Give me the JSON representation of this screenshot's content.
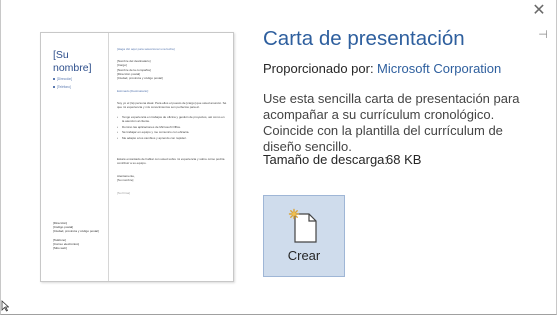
{
  "dialog": {
    "close_label": "✕",
    "pin_label": "⊣"
  },
  "preview": {
    "name_line1": "[Su",
    "name_line2": "nombre]",
    "side_items": [
      "[Dirección]",
      "[Teléfono]"
    ],
    "header_link": "[Haga clic aquí para seleccionar una fecha]",
    "recipient": [
      "[Nombre del destinatario]",
      "[Cargo]",
      "[Nombre de la compañía]",
      "[Dirección postal]",
      "[Ciudad, provincia y código postal]"
    ],
    "salutation": "Estimado [Destinatario]:",
    "body1": "Soy yo el (la) persona ideal. Para ellos el puesto de [cargo] que usted anunció. Sé que mi experiencia y mis conocimientos son perfectos para él.",
    "list_items": [
      "Tengo experiencia en trabajos de oficina y gestión de proyectos, así como en la atención al cliente.",
      "Domino las aplicaciones de Microsoft Office.",
      "Sé trabajar en equipo y me comunico con eficacia.",
      "Me adapto a los cambios y aprendo con rapidez."
    ],
    "body2": "Estaré encantado de hablar con usted sobre mi experiencia y sobre cómo podría contribuir a su equipo.",
    "closing": "Atentamente,",
    "closing_name": "[Su nombre]",
    "signature": "[Su firma]",
    "side_footer": [
      "[Dirección]",
      "[Código postal]",
      "[Ciudad, provincia y código postal]",
      "[Teléfono]",
      "[Correo electrónico]",
      "[Sitio web]"
    ]
  },
  "details": {
    "title": "Carta de presentación",
    "provider_label": "Proporcionado por:",
    "provider_name": "Microsoft Corporation",
    "description": "Use esta sencilla carta de presentación para acompañar a su currículum cronológico. Coincide con la plantilla del currículum de diseño sencillo.",
    "size_label": "Tamaño de descarga:",
    "size_value": "68 KB"
  },
  "create_button": {
    "label": "Crear"
  },
  "colors": {
    "accent": "#2e5f9e",
    "button_bg": "#cfdcec",
    "button_border": "#9fb6d6"
  }
}
